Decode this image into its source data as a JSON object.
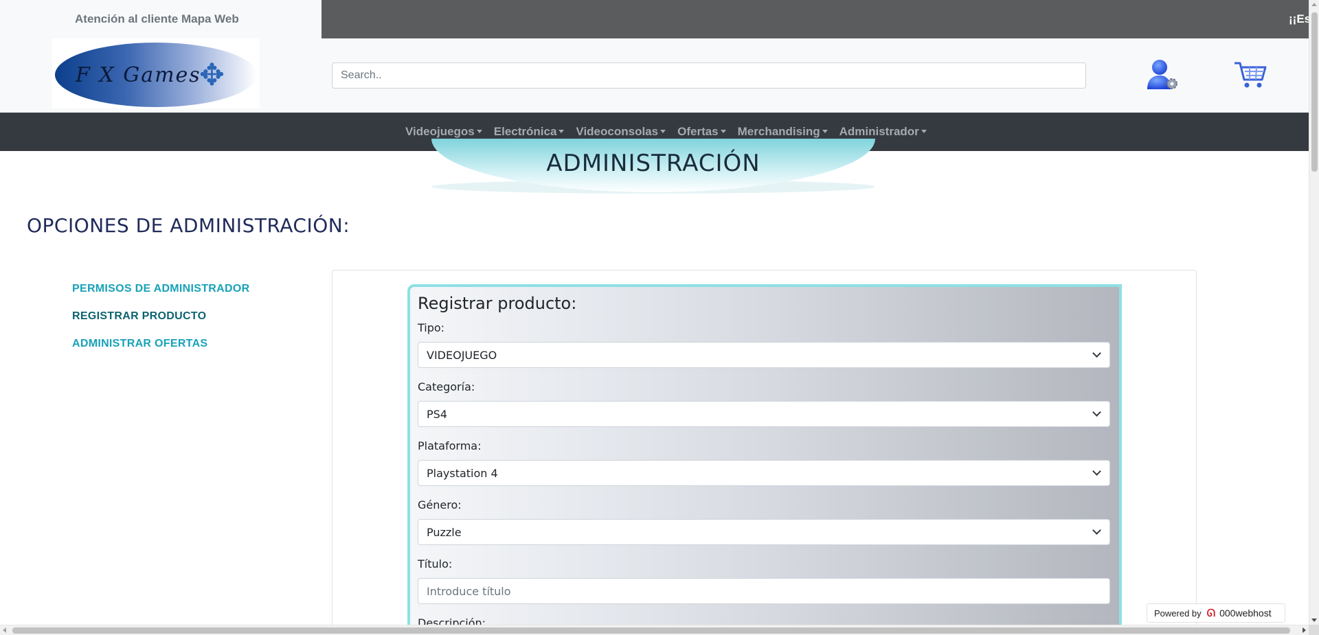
{
  "topbar": {
    "links": [
      "Atención al cliente",
      "Mapa Web"
    ],
    "marquee": "¡¡Es"
  },
  "header": {
    "logo_text": "F X Games",
    "search": {
      "placeholder": "Search..",
      "value": ""
    },
    "user_icon": "user-settings-icon",
    "cart_icon": "shopping-cart-icon"
  },
  "nav": {
    "items": [
      "Videojuegos",
      "Electrónica",
      "Videoconsolas",
      "Ofertas",
      "Merchandising",
      "Administrador"
    ]
  },
  "page": {
    "title": "ADMINISTRACIÓN",
    "section_heading": "OPCIONES DE ADMINISTRACIÓN:"
  },
  "sidebar": {
    "links": [
      "PERMISOS DE ADMINISTRADOR",
      "REGISTRAR PRODUCTO",
      "ADMINISTRAR OFERTAS"
    ]
  },
  "form": {
    "title": "Registrar producto:",
    "fields": [
      {
        "label": "Tipo:",
        "value": "VIDEOJUEGO"
      },
      {
        "label": "Categoría:",
        "value": "PS4"
      },
      {
        "label": "Plataforma:",
        "value": "Playstation 4"
      },
      {
        "label": "Género:",
        "value": "Puzzle"
      },
      {
        "label": "Título:",
        "placeholder": "Introduce título"
      },
      {
        "label": "Descripción:"
      }
    ]
  },
  "footer_badge": {
    "prefix": "Powered by",
    "brand": "000webhost"
  },
  "colors": {
    "topbar_dark": "#5b5c5e",
    "navbar": "#343a40",
    "accent_teal": "#17a2b8",
    "accent_teal_dark": "#0e6370",
    "heading_navy": "#1f2a5a",
    "panel_border": "#8de0e4"
  }
}
